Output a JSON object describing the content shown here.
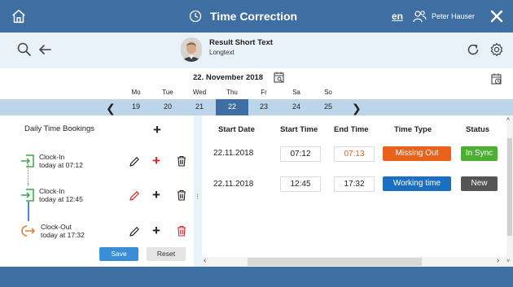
{
  "topbar": {
    "title": "Time Correction",
    "language": "en",
    "user_name": "Peter Hauser",
    "icons": [
      "home-icon",
      "clock-icon",
      "user-group-icon",
      "close-icon"
    ]
  },
  "header": {
    "record_title": "Result Short Text",
    "record_subtitle": "Longtext",
    "icons": [
      "search-icon",
      "back-arrow-icon",
      "refresh-icon",
      "gear-icon"
    ]
  },
  "datebar": {
    "current_date": "22. November 2018",
    "days": [
      {
        "name": "Mo",
        "num": "19"
      },
      {
        "name": "Tue",
        "num": "20"
      },
      {
        "name": "Wed",
        "num": "21"
      },
      {
        "name": "Thu",
        "num": "22"
      },
      {
        "name": "Fr",
        "num": "23"
      },
      {
        "name": "Sa",
        "num": "24"
      },
      {
        "name": "So",
        "num": "25"
      }
    ],
    "prev_symbol": "❮",
    "next_symbol": "❯",
    "selected_index": 3
  },
  "bookings": {
    "title": "Daily Time Bookings",
    "add_symbol": "+",
    "items": [
      {
        "type": "Clock-In",
        "time": "today at 07:12"
      },
      {
        "type": "Clock-In",
        "time": "today at 12:45"
      },
      {
        "type": "Clock-Out",
        "time": "today at 17:32"
      }
    ],
    "save_label": "Save",
    "reset_label": "Reset"
  },
  "table": {
    "columns": [
      "Start Date",
      "Start Time",
      "End Time",
      "Time Type",
      "Status"
    ],
    "rows": [
      {
        "start_date": "22.11.2018",
        "start_time": "07:12",
        "end_time": "07:13",
        "time_type": "Missing Out",
        "status": "In Sync"
      },
      {
        "start_date": "22.11.2018",
        "start_time": "12:45",
        "end_time": "17:32",
        "time_type": "Working time",
        "status": "New"
      }
    ]
  },
  "colors": {
    "primary": "#3f6fa2",
    "clock_in": "#3aa64a",
    "clock_out": "#e8762c",
    "missing_out": "#e8621c",
    "working_time": "#1b6fc0",
    "in_sync": "#4caf34",
    "new": "#555555",
    "delete_red": "#e02020"
  }
}
